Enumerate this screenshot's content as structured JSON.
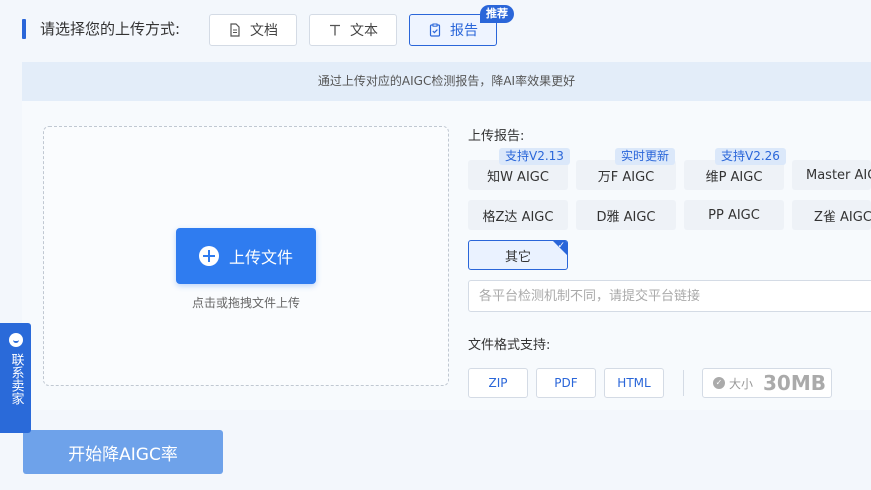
{
  "header": {
    "prompt": "请选择您的上传方式:",
    "modes": [
      {
        "label": "文档",
        "icon": "document-icon"
      },
      {
        "label": "文本",
        "icon": "text-icon"
      },
      {
        "label": "报告",
        "icon": "clipboard-check-icon",
        "active": true
      }
    ],
    "recommend_badge": "推荐"
  },
  "notice": "通过上传对应的AIGC检测报告，降AI率效果更好",
  "upload": {
    "button_label": "上传文件",
    "hint": "点击或拖拽文件上传"
  },
  "report": {
    "label": "上传报告:",
    "platforms": [
      {
        "name": "知W AIGC",
        "tag": "支持V2.13"
      },
      {
        "name": "万F AIGC",
        "tag": "实时更新"
      },
      {
        "name": "维P AIGC",
        "tag": "支持V2.26"
      },
      {
        "name": "Master AIGC",
        "tag": ""
      },
      {
        "name": "格Z达 AIGC",
        "tag": ""
      },
      {
        "name": "D雅 AIGC",
        "tag": ""
      },
      {
        "name": "PP AIGC",
        "tag": ""
      },
      {
        "name": "Z雀 AIGC",
        "tag": ""
      }
    ],
    "other": {
      "name": "其它",
      "selected": true
    },
    "link_placeholder": "各平台检测机制不同，请提交平台链接"
  },
  "formats": {
    "label": "文件格式支持:",
    "items": [
      "ZIP",
      "PDF",
      "HTML"
    ],
    "size_label": "大小",
    "size_value": "30MB"
  },
  "start_button": "开始降AIGC率",
  "side_contact": "联系卖家",
  "colors": {
    "primary": "#2a66d9",
    "upload_button": "#2f7cf0",
    "start_button": "#6ea2ea"
  }
}
